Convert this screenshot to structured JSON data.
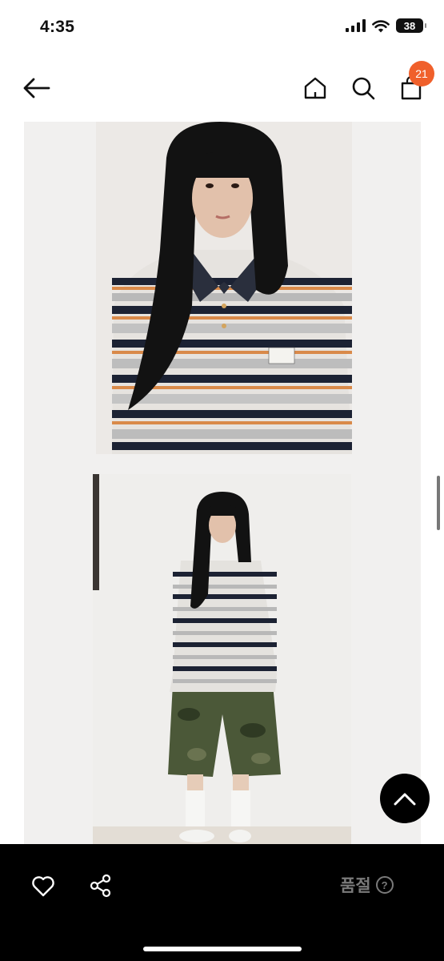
{
  "status_bar": {
    "time": "4:35",
    "battery_level": "38",
    "icons": [
      "signal-icon",
      "wifi-icon",
      "battery-icon"
    ]
  },
  "header": {
    "icons": [
      "back-arrow-icon",
      "home-icon",
      "search-icon",
      "cart-icon"
    ],
    "cart_count": "21",
    "cart_badge_color": "#f0602b"
  },
  "gallery": {
    "images": [
      "model-closeup-striped-polo-photo",
      "model-fullbody-striped-polo-camo-shorts-photo"
    ]
  },
  "floating": {
    "icon": "chevron-up-icon"
  },
  "bottom_bar": {
    "icons": [
      "heart-icon",
      "share-icon"
    ],
    "status_label": "품절",
    "help_icon_glyph": "?"
  },
  "colors": {
    "bottom_bar_bg": "#000000",
    "status_label_color": "#7a7a7a"
  }
}
